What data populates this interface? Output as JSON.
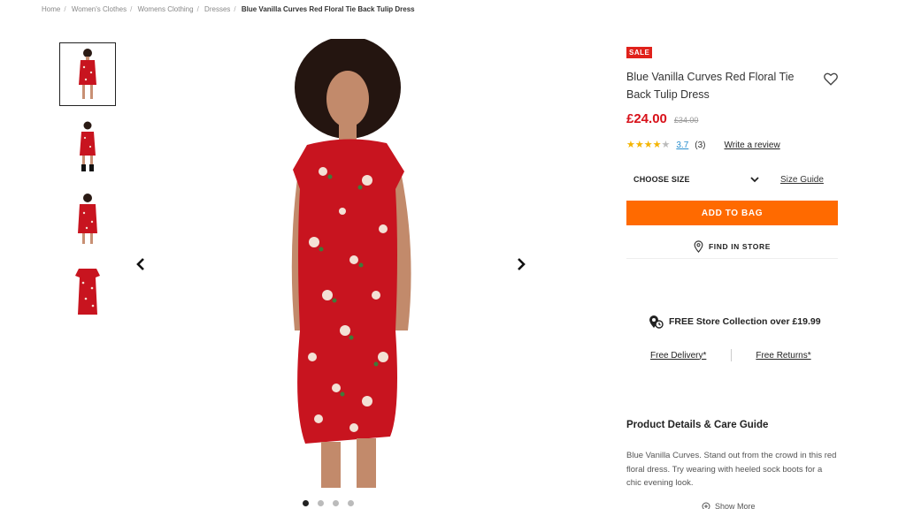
{
  "breadcrumb": {
    "items": [
      "Home",
      "Women's Clothes",
      "Womens Clothing",
      "Dresses"
    ],
    "current": "Blue Vanilla Curves Red Floral Tie Back Tulip Dress"
  },
  "gallery": {
    "thumbnail_count": 4,
    "active_dot": 0,
    "dot_count": 4
  },
  "product": {
    "badge": "SALE",
    "title": "Blue Vanilla Curves Red Floral Tie Back Tulip Dress",
    "price": "£24.00",
    "was_price": "£34.00",
    "rating": "3.7",
    "review_count": "(3)",
    "write_review": "Write a review",
    "stars_filled": 4
  },
  "size": {
    "selected": "CHOOSE SIZE",
    "guide_label": "Size Guide"
  },
  "actions": {
    "add_to_bag": "ADD TO BAG",
    "find_in_store": "FIND IN STORE"
  },
  "delivery": {
    "collection": "FREE Store Collection over £19.99",
    "free_delivery": "Free Delivery*",
    "free_returns": "Free Returns*"
  },
  "details": {
    "heading": "Product Details & Care Guide",
    "description": "Blue Vanilla Curves. Stand out from the crowd in this red floral dress. Try wearing with heeled sock boots for a chic evening look.",
    "show_more": "Show More"
  },
  "colors": {
    "sale_red": "#e0211b",
    "price_red": "#d8111a",
    "cta_orange": "#ff6a00",
    "dress_red": "#c8141f"
  }
}
